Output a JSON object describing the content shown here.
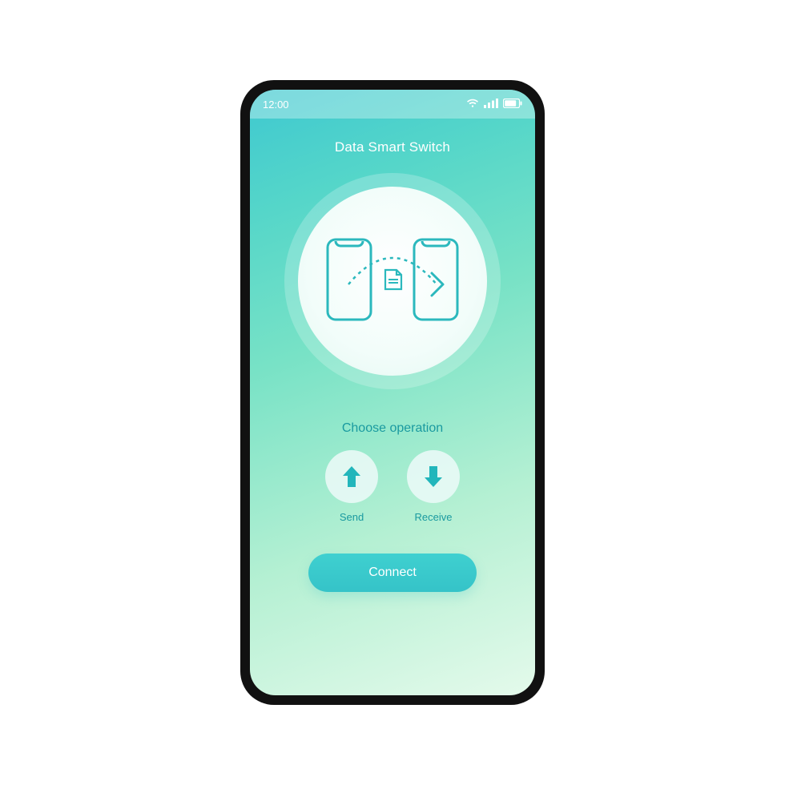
{
  "status": {
    "time": "12:00"
  },
  "header": {
    "title": "Data Smart Switch"
  },
  "main": {
    "choose_label": "Choose operation",
    "ops": {
      "send": "Send",
      "receive": "Receive"
    },
    "connect": "Connect"
  },
  "colors": {
    "accent": "#2bb8bd",
    "text_teal": "#1a9aa0"
  }
}
